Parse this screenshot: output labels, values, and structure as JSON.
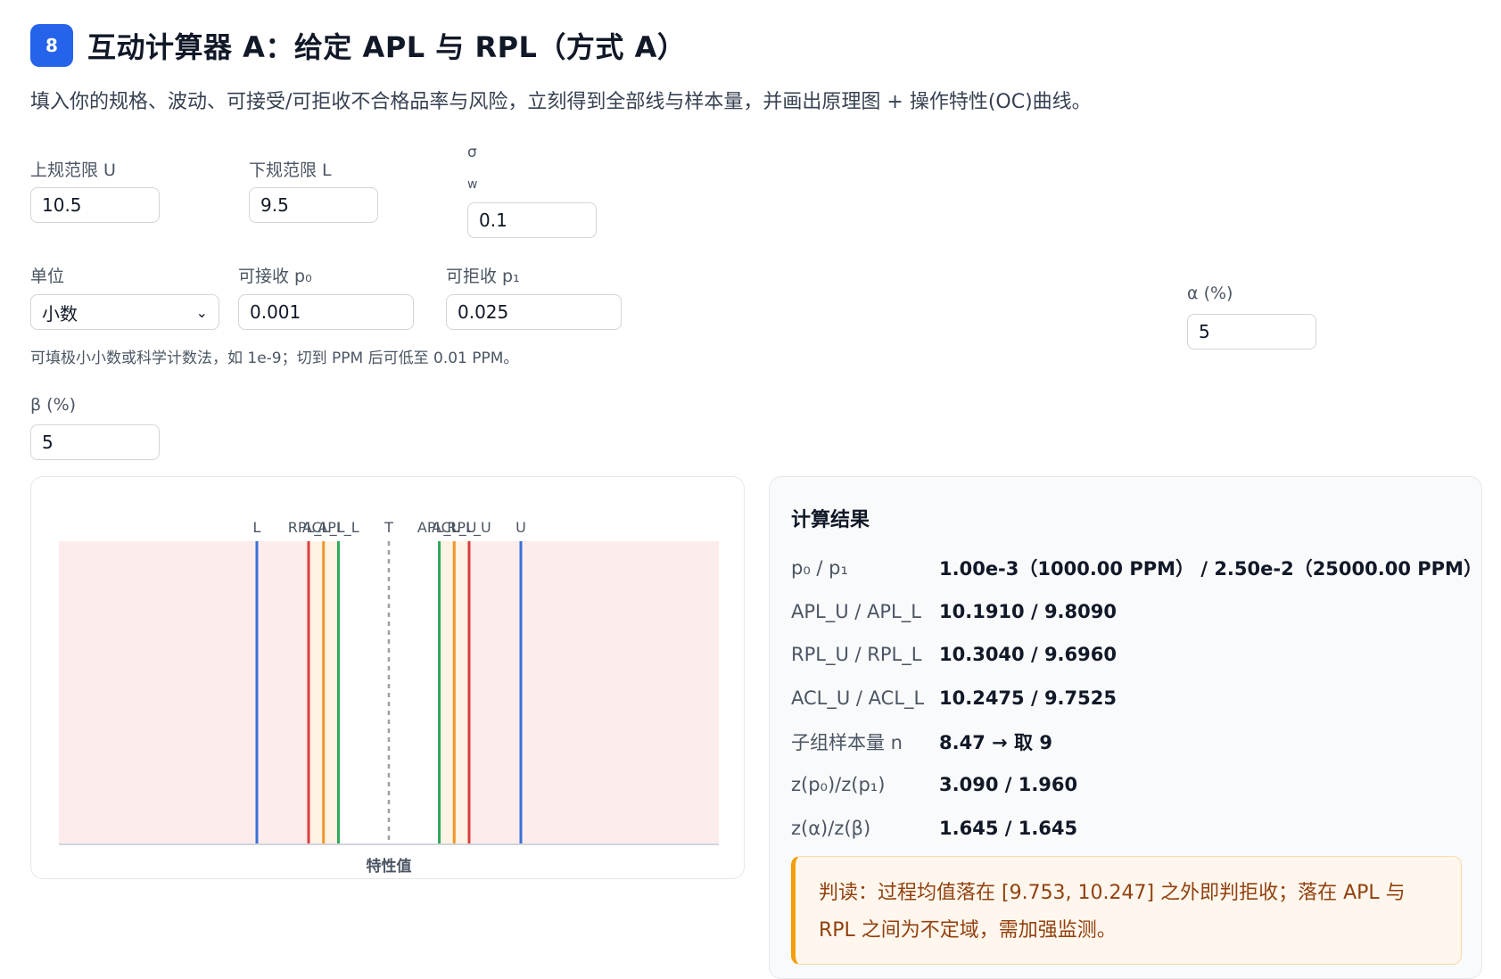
{
  "header": {
    "badge": "8",
    "title": "互动计算器 A：给定 APL 与 RPL（方式 A）"
  },
  "subtitle": "填入你的规格、波动、可接受/可拒收不合格品率与风险，立刻得到全部线与样本量，并画出原理图 + 操作特性(OC)曲线。",
  "inputs": {
    "upper": {
      "label": "上规范限 U",
      "value": "10.5"
    },
    "lower": {
      "label": "下规范限 L",
      "value": "9.5"
    },
    "sigma": {
      "label": "σ",
      "sublabel": "w",
      "value": "0.1"
    },
    "unit": {
      "label": "单位",
      "value": "小数"
    },
    "p0": {
      "label": "可接收 p₀",
      "value": "0.001"
    },
    "p1": {
      "label": "可拒收 p₁",
      "value": "0.025"
    },
    "alpha": {
      "label": "α (%)",
      "value": "5"
    },
    "beta": {
      "label": "β (%)",
      "value": "5"
    },
    "hint": "可填极小小数或科学计数法，如 1e-9；切到 PPM 后可低至 0.01 PPM。"
  },
  "chart_data": {
    "type": "line",
    "xlabel": "特性值",
    "xlim": [
      8.75,
      11.25
    ],
    "lines": [
      {
        "label": "L",
        "x": 9.5,
        "color": "#3b6fd8",
        "dashed": false
      },
      {
        "label": "RPL_L",
        "x": 9.696,
        "color": "#dc3e3e",
        "dashed": false
      },
      {
        "label": "ACL_L",
        "x": 9.7525,
        "color": "#f0962c",
        "dashed": false
      },
      {
        "label": "APL_L",
        "x": 9.809,
        "color": "#2ea85a",
        "dashed": false
      },
      {
        "label": "T",
        "x": 10.0,
        "color": "#9aa0a6",
        "dashed": true
      },
      {
        "label": "APL_U",
        "x": 10.191,
        "color": "#2ea85a",
        "dashed": false
      },
      {
        "label": "ACL_U",
        "x": 10.2475,
        "color": "#f0962c",
        "dashed": false
      },
      {
        "label": "RPL_U",
        "x": 10.304,
        "color": "#dc3e3e",
        "dashed": false
      },
      {
        "label": "U",
        "x": 10.5,
        "color": "#3b6fd8",
        "dashed": false
      }
    ],
    "zones": {
      "reject_color": "#fdecec",
      "indifference_color": "#fef3e4"
    }
  },
  "results": {
    "title": "计算结果",
    "rows": [
      {
        "key": "p₀ / p₁",
        "value": "1.00e-3（1000.00 PPM） / 2.50e-2（25000.00 PPM）"
      },
      {
        "key": "APL_U / APL_L",
        "value": "10.1910 / 9.8090"
      },
      {
        "key": "RPL_U / RPL_L",
        "value": "10.3040 / 9.6960"
      },
      {
        "key": "ACL_U / ACL_L",
        "value": "10.2475 / 9.7525"
      },
      {
        "key": "子组样本量 n",
        "value": "8.47 → 取 9"
      },
      {
        "key": "z(p₀)/z(p₁)",
        "value": "3.090 / 1.960"
      },
      {
        "key": "z(α)/z(β)",
        "value": "1.645 / 1.645"
      }
    ],
    "verdict": "判读：过程均值落在 [9.753, 10.247] 之外即判拒收；落在 APL 与 RPL 之间为不定域，需加强监测。"
  }
}
